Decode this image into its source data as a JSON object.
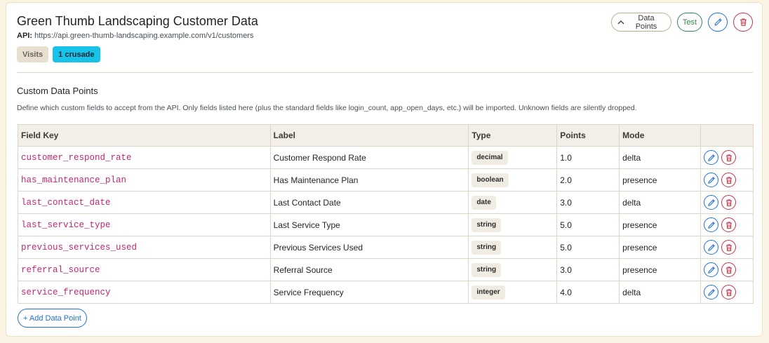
{
  "header": {
    "title": "Green Thumb Landscaping Customer Data",
    "api_label": "API:",
    "api_url": "https://api.green-thumb-landscaping.example.com/v1/customers",
    "badges": [
      "Visits",
      "1 crusade"
    ]
  },
  "actions": {
    "data_points_label": "Data Points",
    "test_label": "Test",
    "edit_icon": "pencil-icon",
    "delete_icon": "trash-icon"
  },
  "section": {
    "title": "Custom Data Points",
    "description": "Define which custom fields to accept from the API. Only fields listed here (plus the standard fields like login_count, app_open_days, etc.) will be imported. Unknown fields are silently dropped."
  },
  "table": {
    "headers": [
      "Field Key",
      "Label",
      "Type",
      "Points",
      "Mode",
      ""
    ],
    "rows": [
      {
        "key": "customer_respond_rate",
        "label": "Customer Respond Rate",
        "type": "decimal",
        "points": "1.0",
        "mode": "delta"
      },
      {
        "key": "has_maintenance_plan",
        "label": "Has Maintenance Plan",
        "type": "boolean",
        "points": "2.0",
        "mode": "presence"
      },
      {
        "key": "last_contact_date",
        "label": "Last Contact Date",
        "type": "date",
        "points": "3.0",
        "mode": "delta"
      },
      {
        "key": "last_service_type",
        "label": "Last Service Type",
        "type": "string",
        "points": "5.0",
        "mode": "presence"
      },
      {
        "key": "previous_services_used",
        "label": "Previous Services Used",
        "type": "string",
        "points": "5.0",
        "mode": "presence"
      },
      {
        "key": "referral_source",
        "label": "Referral Source",
        "type": "string",
        "points": "3.0",
        "mode": "presence"
      },
      {
        "key": "service_frequency",
        "label": "Service Frequency",
        "type": "integer",
        "points": "4.0",
        "mode": "delta"
      }
    ]
  },
  "footer": {
    "add_label": "+ Add Data Point"
  },
  "colors": {
    "background": "#fbf3e3",
    "key_text": "#c7256f",
    "edit": "#1e6fd9",
    "delete": "#c8334a",
    "test": "#2e8a52",
    "badge_crusade": "#17c3e8"
  }
}
